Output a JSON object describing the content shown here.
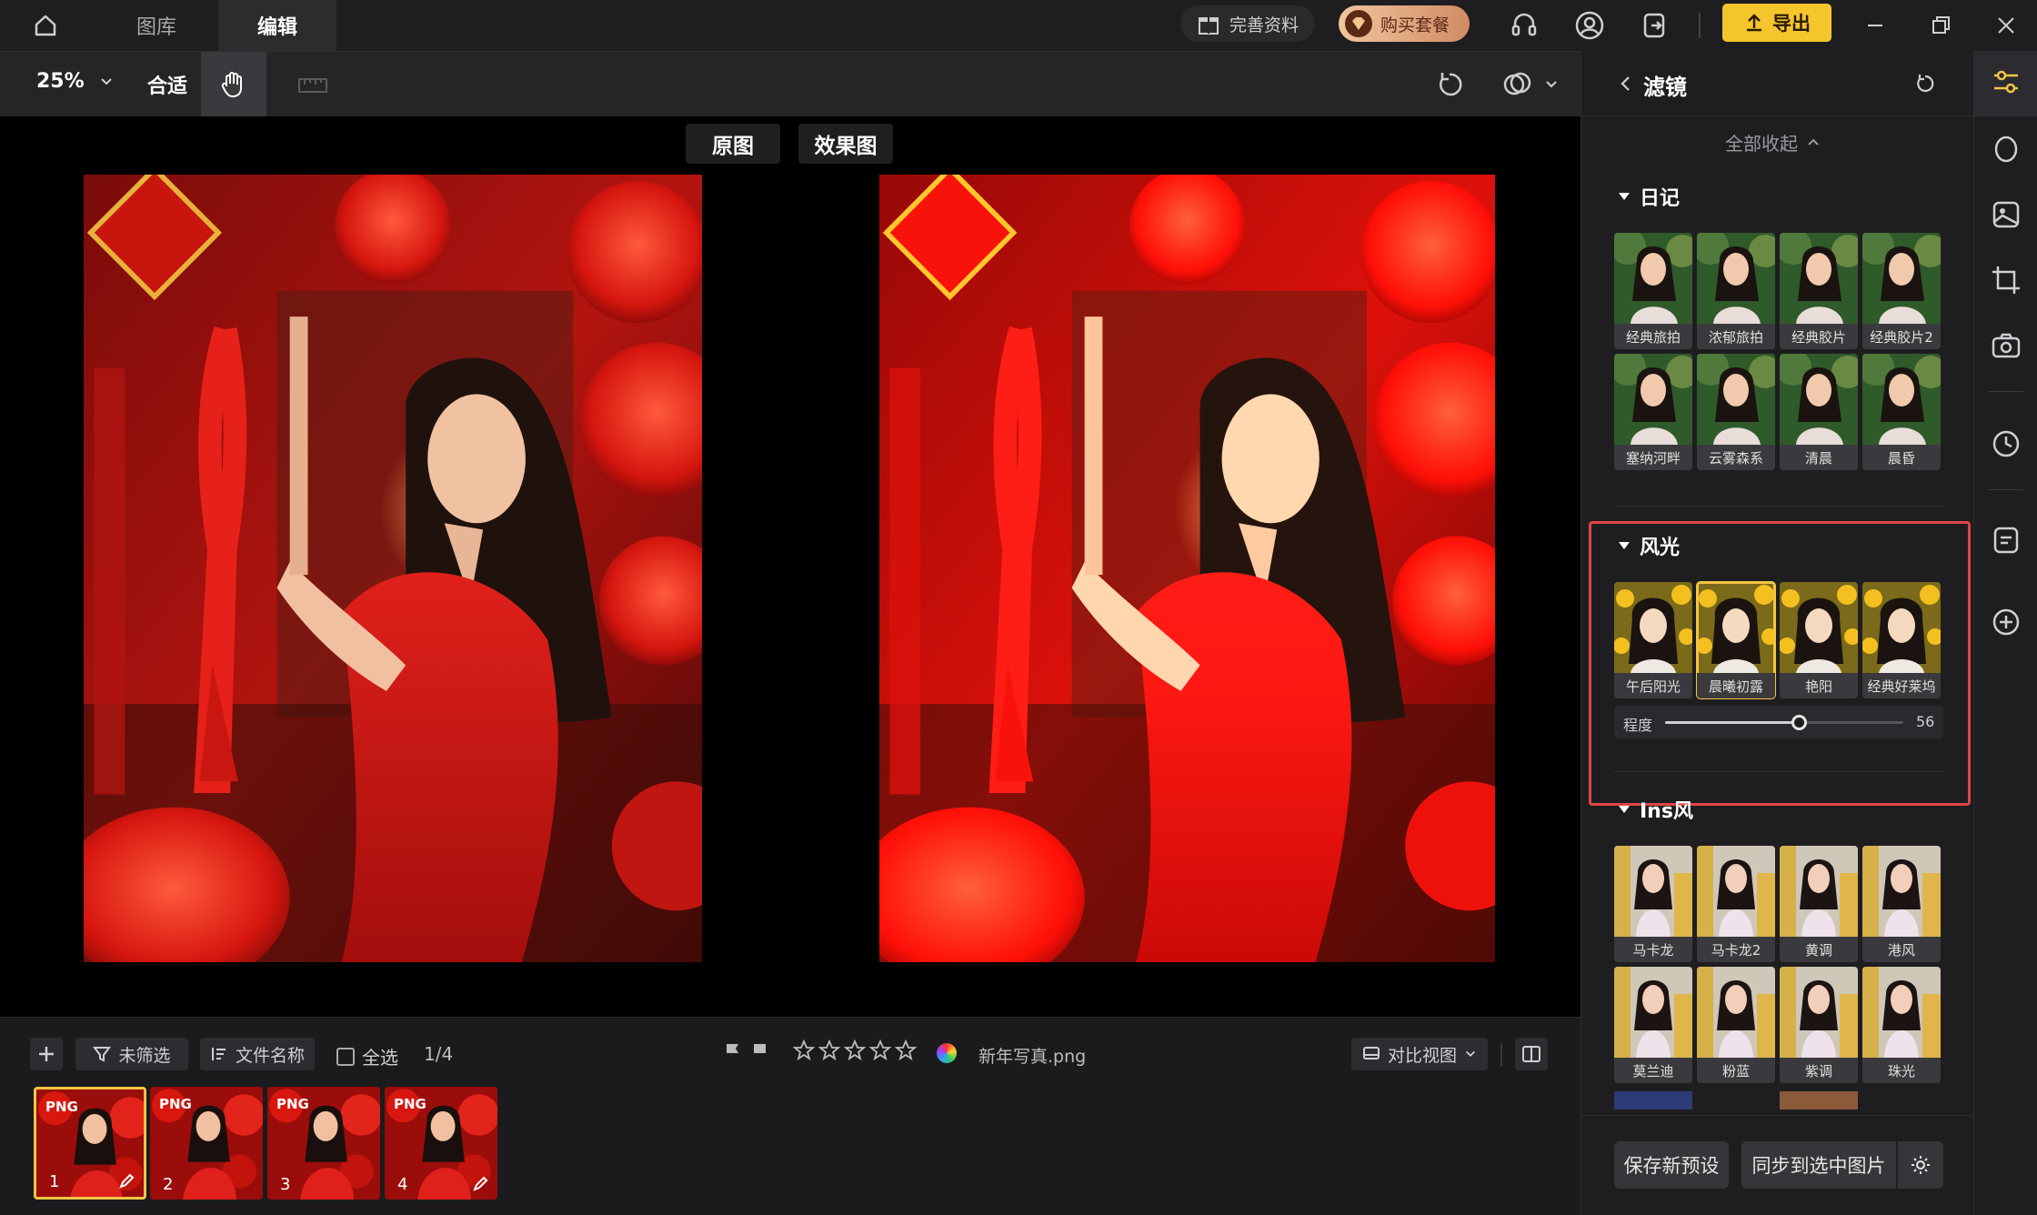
{
  "topbar": {
    "tabs": [
      {
        "label": "图库"
      },
      {
        "label": "编辑"
      }
    ],
    "complete_profile": "完善资料",
    "buy_package": "购买套餐",
    "export": "导出"
  },
  "toolbar": {
    "zoom": "25%",
    "fit": "合适"
  },
  "compare": {
    "original": "原图",
    "effect": "效果图"
  },
  "bottom": {
    "filter_label": "未筛选",
    "sort_label": "文件名称",
    "select_all": "全选",
    "page": "1/4",
    "filename": "新年写真.png",
    "compare_view": "对比视图",
    "thumbs": [
      {
        "tag": "PNG",
        "num": "1"
      },
      {
        "tag": "PNG",
        "num": "2"
      },
      {
        "tag": "PNG",
        "num": "3"
      },
      {
        "tag": "PNG",
        "num": "4"
      }
    ]
  },
  "panel": {
    "title": "滤镜",
    "collapse_all": "全部收起",
    "sections": [
      {
        "title": "日记",
        "items": [
          "经典旅拍",
          "浓郁旅拍",
          "经典胶片",
          "经典胶片2",
          "塞纳河畔",
          "云雾森系",
          "清晨",
          "晨昏"
        ]
      },
      {
        "title": "风光",
        "items": [
          "午后阳光",
          "晨曦初露",
          "艳阳",
          "经典好莱坞"
        ]
      },
      {
        "title": "Ins风",
        "items": [
          "马卡龙",
          "马卡龙2",
          "黄调",
          "港风",
          "莫兰迪",
          "粉蓝",
          "紫调",
          "珠光"
        ]
      }
    ],
    "slider": {
      "label": "程度",
      "value": "56",
      "fraction": 0.56
    },
    "save_preset": "保存新预设",
    "sync": "同步到选中图片"
  },
  "colors": {
    "accent": "#f4c544",
    "highlight_border": "#e04545"
  }
}
